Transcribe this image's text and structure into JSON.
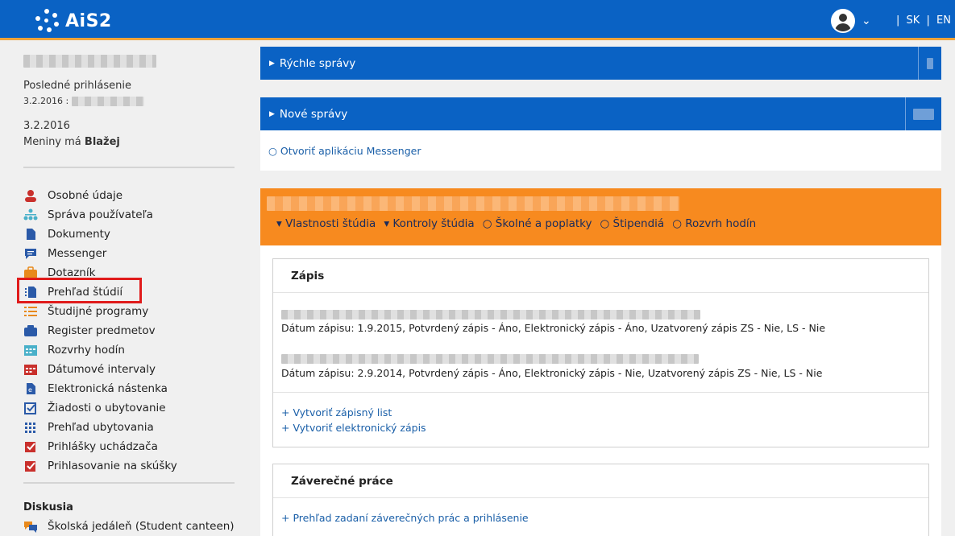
{
  "header": {
    "logo_text": "AiS2",
    "lang_sep1": "|",
    "lang_sk": "SK",
    "lang_sep2": "|",
    "lang_en": "EN"
  },
  "sidebar": {
    "last_login_label": "Posledné prihlásenie",
    "last_login_date": "3.2.2016 :",
    "today": "3.2.2016",
    "nameday_prefix": "Meniny má",
    "nameday_name": "Blažej",
    "items": [
      {
        "label": "Osobné údaje",
        "icon": "person-icon"
      },
      {
        "label": "Správa používateľa",
        "icon": "users-tree-icon"
      },
      {
        "label": "Dokumenty",
        "icon": "document-icon"
      },
      {
        "label": "Messenger",
        "icon": "chat-icon"
      },
      {
        "label": "Dotazník",
        "icon": "briefcase-icon"
      },
      {
        "label": "Prehľad štúdií",
        "icon": "list-document-icon"
      },
      {
        "label": "Študijné programy",
        "icon": "list-icon"
      },
      {
        "label": "Register predmetov",
        "icon": "folder-icon"
      },
      {
        "label": "Rozvrhy hodín",
        "icon": "timetable-icon"
      },
      {
        "label": "Dátumové intervaly",
        "icon": "calendar-icon"
      },
      {
        "label": "Elektronická nástenka",
        "icon": "board-icon"
      },
      {
        "label": "Žiadosti o ubytovanie",
        "icon": "check-box-icon"
      },
      {
        "label": "Prehľad ubytovania",
        "icon": "grid-dots-icon"
      },
      {
        "label": "Prihlášky uchádzača",
        "icon": "checked-box-icon"
      },
      {
        "label": "Prihlasovanie na skúšky",
        "icon": "checked-box-icon"
      }
    ],
    "discussion_title": "Diskusia",
    "discussion_item": "Školská jedáleň (Student canteen)"
  },
  "panels": {
    "quick_messages": "Rýchle správy",
    "new_messages": "Nové správy",
    "messenger_link": "○ Otvoriť aplikáciu Messenger"
  },
  "study": {
    "nav": [
      "▾ Vlastnosti štúdia",
      "▾ Kontroly štúdia",
      "○ Školné a poplatky",
      "○ Štipendiá",
      "○ Rozvrh hodín"
    ],
    "zapis_title": "Zápis",
    "zapis_rows": [
      "Dátum zápisu: 1.9.2015, Potvrdený zápis - Áno, Elektronický zápis - Áno, Uzatvorený zápis ZS - Nie, LS - Nie",
      "Dátum zápisu: 2.9.2014, Potvrdený zápis - Áno, Elektronický zápis - Nie, Uzatvorený zápis ZS - Nie, LS - Nie"
    ],
    "create_list": "+ Vytvoriť zápisný list",
    "create_electronic": "+ Vytvoriť elektronický zápis",
    "thesis_title": "Záverečné práce",
    "thesis_link": "+ Prehľad zadaní záverečných prác a prihlásenie"
  },
  "colors": {
    "header_blue": "#0a62c4",
    "accent_orange": "#f78a1f",
    "link_blue": "#1a5fa8",
    "highlight_red": "#e01b1b"
  }
}
